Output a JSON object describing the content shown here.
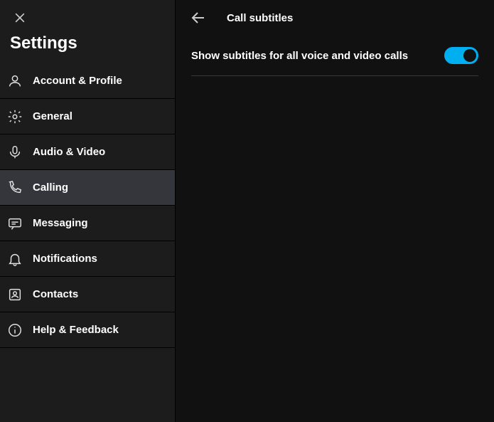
{
  "sidebar": {
    "title": "Settings",
    "items": [
      {
        "label": "Account & Profile"
      },
      {
        "label": "General"
      },
      {
        "label": "Audio & Video"
      },
      {
        "label": "Calling"
      },
      {
        "label": "Messaging"
      },
      {
        "label": "Notifications"
      },
      {
        "label": "Contacts"
      },
      {
        "label": "Help & Feedback"
      }
    ],
    "selected_index": 3
  },
  "main": {
    "title": "Call subtitles",
    "option_label": "Show subtitles for all voice and video calls",
    "toggle_on": true
  }
}
